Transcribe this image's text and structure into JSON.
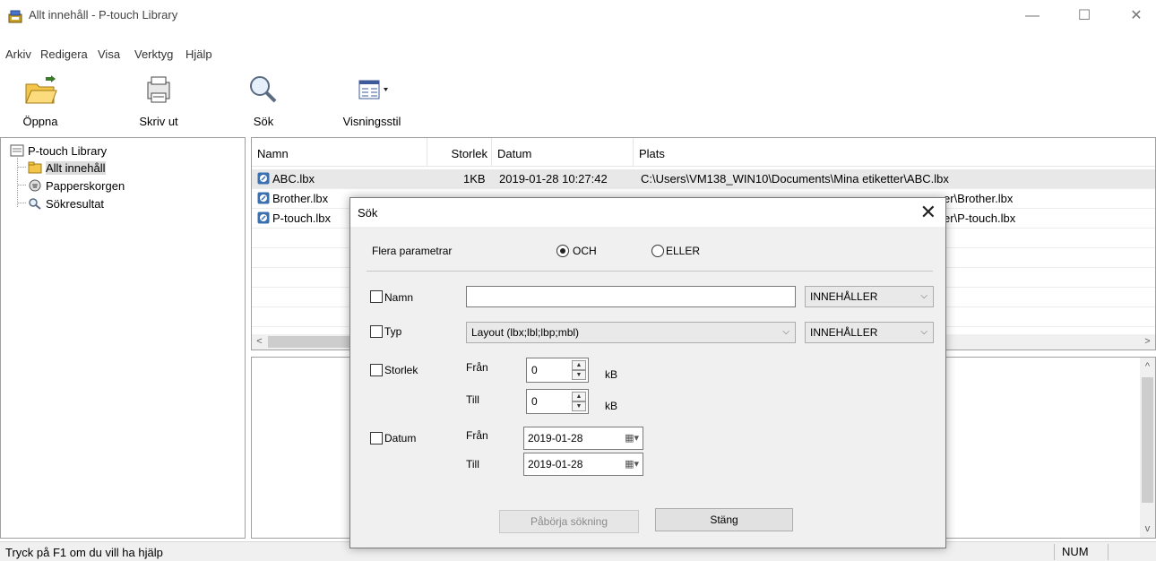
{
  "window": {
    "title": "Allt innehåll - P-touch Library"
  },
  "menu": [
    "Arkiv",
    "Redigera",
    "Visa",
    "Verktyg",
    "Hjälp"
  ],
  "toolbar": {
    "open": "Öppna",
    "print": "Skriv ut",
    "search": "Sök",
    "view_style": "Visningsstil"
  },
  "tree": {
    "root": "P-touch Library",
    "items": [
      "Allt innehåll",
      "Papperskorgen",
      "Sökresultat"
    ]
  },
  "list": {
    "columns": [
      "Namn",
      "Storlek",
      "Datum",
      "Plats"
    ],
    "rows": [
      {
        "name": "ABC.lbx",
        "size": "1KB",
        "date": "2019-01-28 10:27:42",
        "location": "C:\\Users\\VM138_WIN10\\Documents\\Mina etiketter\\ABC.lbx"
      },
      {
        "name": "Brother.lbx",
        "location_tail": "er\\Brother.lbx"
      },
      {
        "name": "P-touch.lbx",
        "location_tail": "er\\P-touch.lbx"
      }
    ]
  },
  "status": {
    "help": "Tryck på F1 om du vill ha hjälp",
    "num": "NUM"
  },
  "dialog": {
    "title": "Sök",
    "multi_params": "Flera parametrar",
    "and": "OCH",
    "or": "ELLER",
    "name_label": "Namn",
    "name_value": "",
    "name_op": "INNEHÅLLER",
    "type_label": "Typ",
    "type_value": "Layout (lbx;lbl;lbp;mbl)",
    "type_op": "INNEHÅLLER",
    "size_label": "Storlek",
    "from": "Från",
    "to": "Till",
    "size_from": "0",
    "size_to": "0",
    "unit": "kB",
    "date_label": "Datum",
    "date_from": "2019-01-28",
    "date_to": "2019-01-28",
    "start_button": "Påbörja sökning",
    "close_button": "Stäng"
  }
}
